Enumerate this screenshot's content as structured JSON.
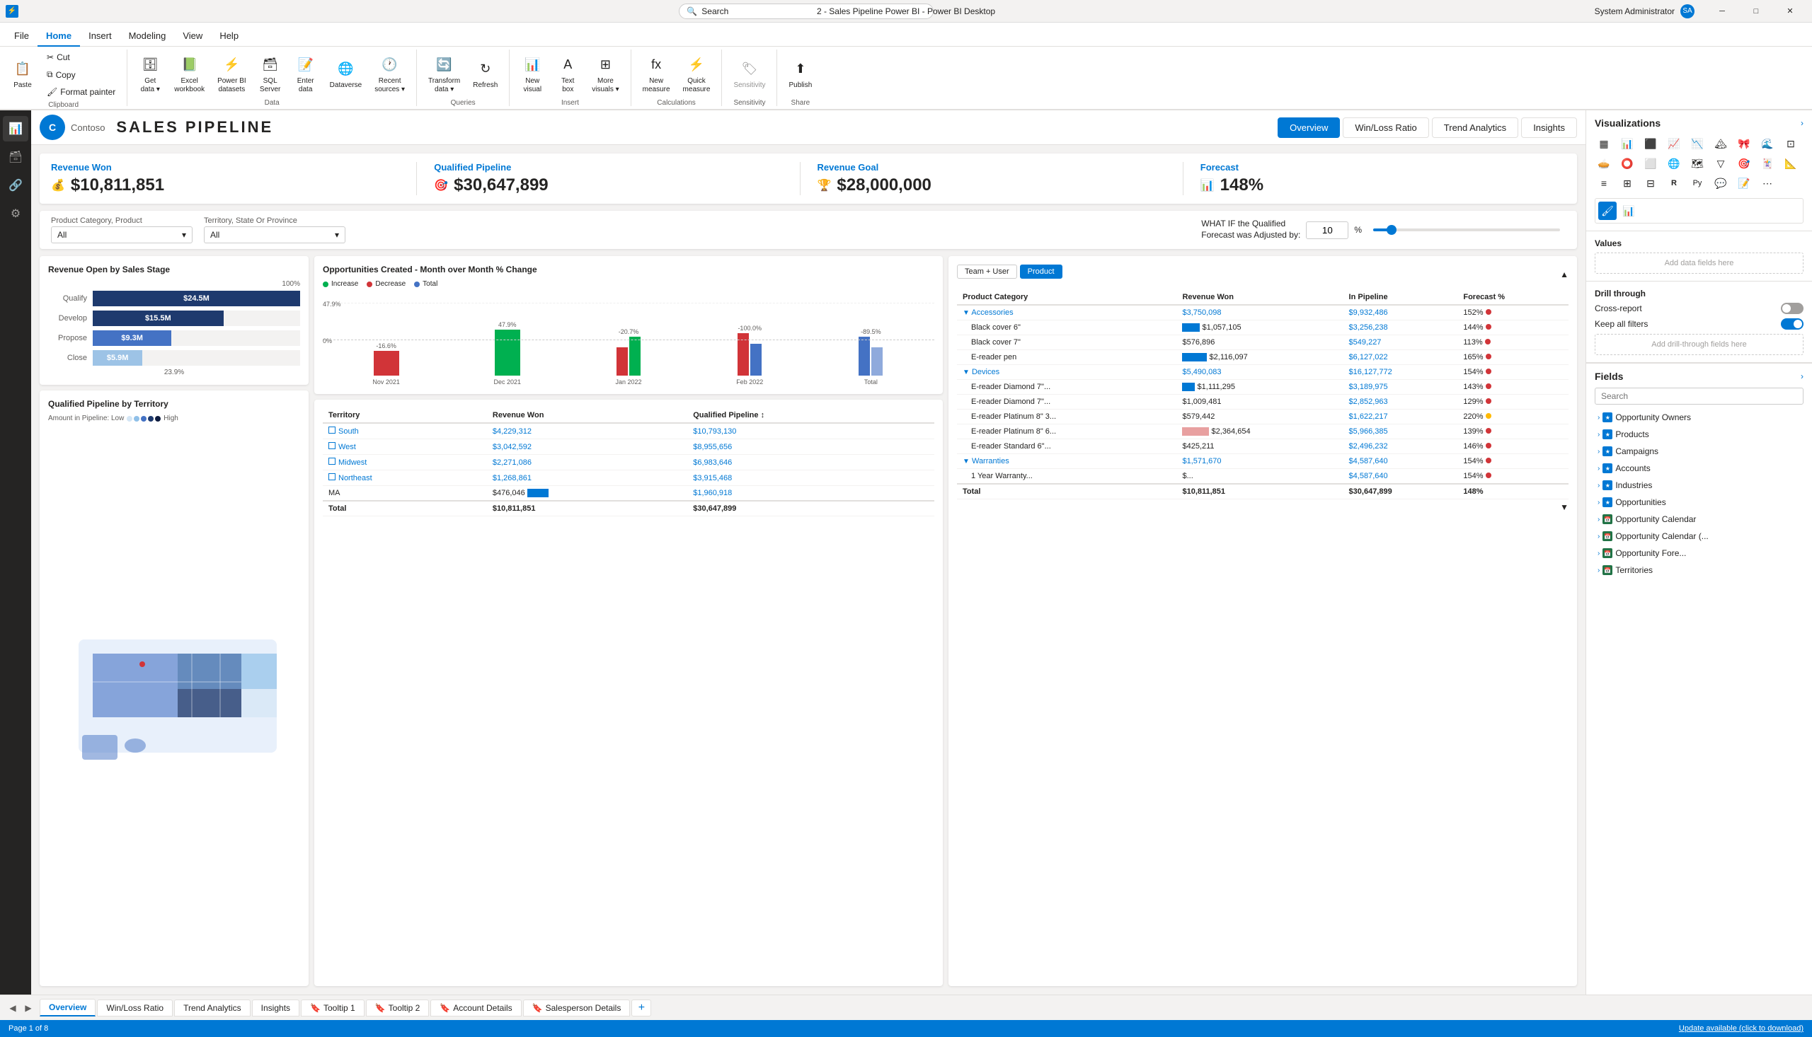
{
  "titleBar": {
    "title": "2 - Sales Pipeline Power BI - Power BI Desktop",
    "search": "Search",
    "user": "System Administrator"
  },
  "ribbon": {
    "tabs": [
      "File",
      "Home",
      "Insert",
      "Modeling",
      "View",
      "Help"
    ],
    "activeTab": "Home",
    "groups": {
      "clipboard": {
        "label": "Clipboard",
        "items": [
          "Paste",
          "Cut",
          "Copy",
          "Format painter"
        ]
      },
      "data": {
        "label": "Data",
        "items": [
          "Get data",
          "Excel workbook",
          "Power BI datasets",
          "SQL Server",
          "Enter data",
          "Dataverse",
          "Recent sources"
        ]
      },
      "queries": {
        "label": "Queries",
        "items": [
          "Transform data",
          "Refresh"
        ]
      },
      "insert": {
        "label": "Insert",
        "items": [
          "New visual",
          "Text box",
          "More visuals"
        ]
      },
      "calculations": {
        "label": "Calculations",
        "items": [
          "New measure",
          "Quick measure"
        ]
      },
      "sensitivity": {
        "label": "Sensitivity",
        "items": [
          "Sensitivity"
        ]
      },
      "share": {
        "label": "Share",
        "items": [
          "Publish"
        ]
      }
    }
  },
  "header": {
    "logoText": "C",
    "companyName": "Contoso",
    "reportTitle": "SALES PIPELINE",
    "navTabs": [
      "Overview",
      "Win/Loss Ratio",
      "Trend Analytics",
      "Insights"
    ],
    "activeNavTab": "Overview"
  },
  "kpis": [
    {
      "label": "Revenue Won",
      "value": "$10,811,851",
      "icon": "💰"
    },
    {
      "label": "Qualified Pipeline",
      "value": "$30,647,899",
      "icon": "🎯"
    },
    {
      "label": "Revenue Goal",
      "value": "$28,000,000",
      "icon": "🏆"
    },
    {
      "label": "Forecast",
      "value": "148%",
      "icon": "📊"
    }
  ],
  "filters": {
    "productCategory": {
      "label": "Product Category, Product",
      "value": "All"
    },
    "territory": {
      "label": "Territory, State Or Province",
      "value": "All"
    },
    "whatIf": {
      "label": "WHAT IF the Qualified Forecast was Adjusted by:",
      "value": "10",
      "unit": "%"
    }
  },
  "revenueByStage": {
    "title": "Revenue Open by Sales Stage",
    "bars": [
      {
        "label": "Qualify",
        "value": "$24.5M",
        "pct": 100,
        "color": "#1e3a6e"
      },
      {
        "label": "Develop",
        "value": "$15.5M",
        "pct": 63,
        "color": "#1e3a6e"
      },
      {
        "label": "Propose",
        "value": "$9.3M",
        "pct": 38,
        "color": "#4472c4"
      },
      {
        "label": "Close",
        "value": "$5.9M",
        "pct": 24,
        "color": "#9dc3e6"
      }
    ],
    "bottomPct": "23.9%"
  },
  "opportunitiesChart": {
    "title": "Opportunities Created - Month over Month % Change",
    "legend": [
      "Increase",
      "Decrease",
      "Total"
    ],
    "periods": [
      "Nov 2021",
      "Dec 2021",
      "Jan 2022",
      "Feb 2022",
      "Total"
    ],
    "values": [
      -16.6,
      47.9,
      -20.7,
      -100.0,
      -89.5
    ],
    "annotations": [
      "-16.6%",
      "47.9%",
      "-20.7%",
      "-100.0%",
      "-89.5%"
    ]
  },
  "qualifiedPipeline": {
    "title": "Qualified Pipeline by Territory",
    "legendLabel": "Amount in Pipeline: Low",
    "legendHigh": "High"
  },
  "territoryTable": {
    "columns": [
      "Territory",
      "Revenue Won",
      "Qualified Pipeline"
    ],
    "rows": [
      {
        "name": "South",
        "revenueWon": "$4,229,312",
        "qualifiedPipeline": "$10,793,130"
      },
      {
        "name": "West",
        "revenueWon": "$3,042,592",
        "qualifiedPipeline": "$8,955,656"
      },
      {
        "name": "Midwest",
        "revenueWon": "$2,271,086",
        "qualifiedPipeline": "$6,983,646"
      },
      {
        "name": "Northeast",
        "revenueWon": "$1,268,861",
        "qualifiedPipeline": "$3,915,468"
      },
      {
        "name": "MA",
        "revenueWon": "$476,046",
        "qualifiedPipeline": "$1,960,918"
      }
    ],
    "total": {
      "label": "Total",
      "revenueWon": "$10,811,851",
      "qualifiedPipeline": "$30,647,899"
    }
  },
  "productTable": {
    "columns": [
      "Product Category",
      "Revenue Won",
      "In Pipeline",
      "Forecast %"
    ],
    "toggles": [
      "Team + User",
      "Product"
    ],
    "activeToggle": "Product",
    "categories": [
      {
        "name": "Accessories",
        "revenueWon": "$3,750,098",
        "inPipeline": "$9,932,486",
        "forecast": "152%",
        "indicator": "red",
        "products": [
          {
            "name": "Black cover 6\"",
            "revenueWon": "$1,057,105",
            "inPipeline": "$3,256,238",
            "forecast": "144%",
            "indicator": "red"
          },
          {
            "name": "Black cover 7\"",
            "revenueWon": "$576,896",
            "inPipeline": "$549,227",
            "forecast": "113%",
            "indicator": "red"
          },
          {
            "name": "E-reader pen",
            "revenueWon": "$2,116,097",
            "inPipeline": "$6,127,022",
            "forecast": "165%",
            "indicator": "red"
          }
        ]
      },
      {
        "name": "Devices",
        "revenueWon": "$5,490,083",
        "inPipeline": "$16,127,772",
        "forecast": "154%",
        "indicator": "red",
        "products": [
          {
            "name": "E-reader Diamond 7\"...",
            "revenueWon": "$1,111,295",
            "inPipeline": "$3,189,975",
            "forecast": "143%",
            "indicator": "red"
          },
          {
            "name": "E-reader Diamond 7\"...",
            "revenueWon": "$1,009,481",
            "inPipeline": "$2,852,963",
            "forecast": "129%",
            "indicator": "red"
          },
          {
            "name": "E-reader Platinum 8\" 3...",
            "revenueWon": "$579,442",
            "inPipeline": "$1,622,217",
            "forecast": "220%",
            "indicator": "yellow"
          },
          {
            "name": "E-reader Platinum 8\" 6...",
            "revenueWon": "$2,364,654",
            "inPipeline": "$5,966,385",
            "forecast": "139%",
            "indicator": "red"
          },
          {
            "name": "E-reader Standard 6\"...",
            "revenueWon": "$425,211",
            "inPipeline": "$2,496,232",
            "forecast": "146%",
            "indicator": "red"
          }
        ]
      },
      {
        "name": "Warranties",
        "revenueWon": "$1,571,670",
        "inPipeline": "$4,587,640",
        "forecast": "154%",
        "indicator": "red",
        "products": [
          {
            "name": "1 Year Warranty...",
            "revenueWon": "$...",
            "inPipeline": "$4,587,640",
            "forecast": "154%",
            "indicator": "red"
          }
        ]
      }
    ],
    "total": {
      "label": "Total",
      "revenueWon": "$10,811,851",
      "inPipeline": "$30,647,899",
      "forecast": "148%"
    }
  },
  "visualizations": {
    "title": "Visualizations",
    "icons": [
      "▦",
      "📊",
      "📈",
      "📉",
      "🗂",
      "⬜",
      "🔢",
      "🎯",
      "★",
      "📋",
      "🌐",
      "🔵",
      "⭕",
      "💧",
      "🌊",
      "🔷",
      "🎠",
      "Ω",
      "R",
      "Py",
      "🔗",
      "💬",
      "🖼",
      "📐",
      "⚙"
    ]
  },
  "fields": {
    "title": "Fields",
    "searchPlaceholder": "Search",
    "groups": [
      {
        "name": "Opportunity Owners",
        "icon": "★"
      },
      {
        "name": "Products",
        "icon": "★"
      },
      {
        "name": "Campaigns",
        "icon": "★"
      },
      {
        "name": "Accounts",
        "icon": "★"
      },
      {
        "name": "Industries",
        "icon": "★"
      },
      {
        "name": "Opportunities",
        "icon": "★"
      },
      {
        "name": "Opportunity Calendar",
        "icon": "📅"
      },
      {
        "name": "Opportunity Calendar (",
        "icon": "📅"
      },
      {
        "name": "Opportunity Fore...",
        "icon": "📅"
      },
      {
        "name": "Territories",
        "icon": "📅"
      }
    ]
  },
  "values": {
    "title": "Values",
    "placeholder": "Add data fields here"
  },
  "drillThrough": {
    "title": "Drill through",
    "crossReport": "Cross-report",
    "crossReportState": "Off",
    "keepAllFilters": "Keep all filters",
    "keepAllFiltersState": "On",
    "placeholder": "Add drill-through fields here"
  },
  "bottomTabs": {
    "pageIndicator": "Page 1 of 8",
    "tabs": [
      "Overview",
      "Win/Loss Ratio",
      "Trend Analytics",
      "Insights",
      "Tooltip 1",
      "Tooltip 2",
      "Account Details",
      "Salesperson Details"
    ],
    "activeTab": "Overview"
  },
  "statusBar": {
    "left": "Page 1 of 8",
    "right": "Update available (click to download)"
  }
}
